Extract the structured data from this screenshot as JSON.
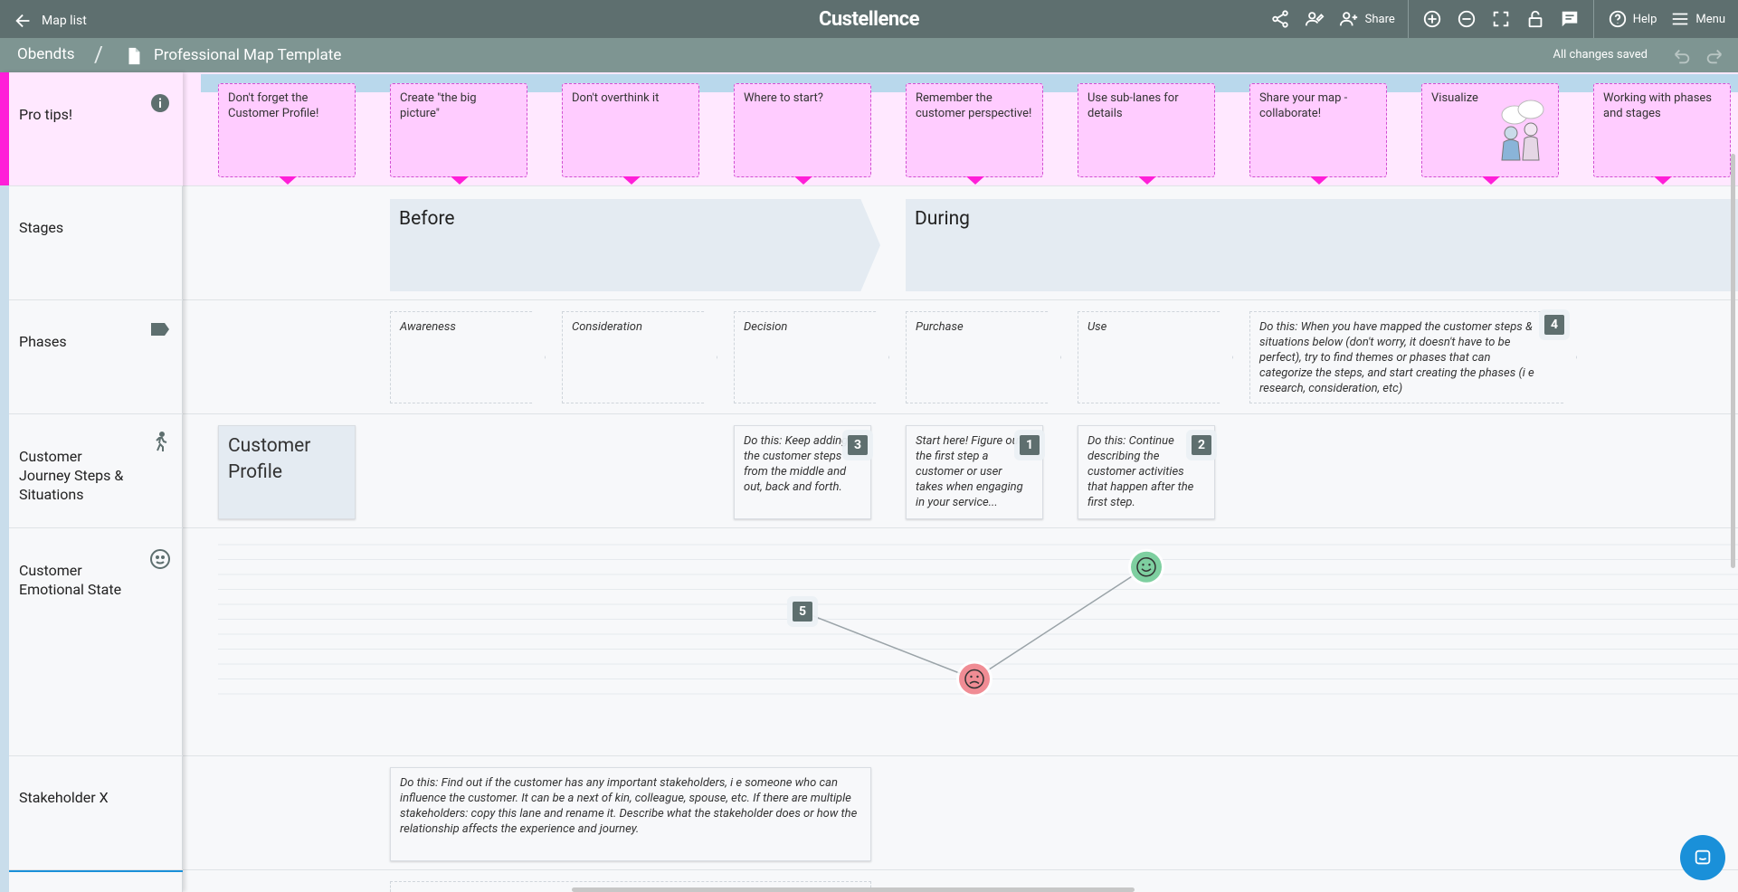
{
  "topbar": {
    "back_label": "Map list",
    "logo": "Custellence",
    "share_label": "Share",
    "help_label": "Help",
    "menu_label": "Menu"
  },
  "subbar": {
    "workspace": "Obendts",
    "separator": "/",
    "map_title": "Professional Map Template",
    "save_status": "All changes saved"
  },
  "lanes": [
    {
      "label": "Pro tips!",
      "icon": "info-icon"
    },
    {
      "label": "Stages",
      "icon": ""
    },
    {
      "label": "Phases",
      "icon": "tag-icon"
    },
    {
      "label": "Customer Journey Steps & Situations",
      "icon": "walking-person-icon"
    },
    {
      "label": "Customer Emotional State",
      "icon": "smiley-icon"
    },
    {
      "label": "Stakeholder X",
      "icon": ""
    }
  ],
  "pro_tips": [
    "Don't forget the Customer Profile!",
    "Create \"the big picture\"",
    "Don't overthink it",
    "Where to start?",
    "Remember the customer perspective!",
    "Use sub-lanes for details",
    "Share your map - collaborate!",
    "Visualize",
    "Working with phases and stages"
  ],
  "stages": [
    "Before",
    "During"
  ],
  "phases": {
    "items": [
      "Awareness",
      "Consideration",
      "Decision",
      "Purchase",
      "Use"
    ],
    "hint": "Do this: When you have mapped the customer steps & situations below (don't worry, it doesn't have to be perfect), try to find themes or phases that can categorize the steps, and start creating the phases (i e research, consideration, etc)",
    "hint_badge": "4"
  },
  "steps": {
    "profile_title": "Customer Profile",
    "cards": [
      {
        "text": "Do this: Keep adding the customer steps from the middle and out, back and forth.",
        "badge": "3"
      },
      {
        "text": "Start here! Figure out the first step a customer or user takes when engaging in your service...",
        "badge": "1"
      },
      {
        "text": "Do this: Continue describing the customer activities that happen after the first step.",
        "badge": "2"
      }
    ]
  },
  "emotions": {
    "badge": "5",
    "points": [
      {
        "step": "Decision",
        "level": 0.55,
        "mood": "neutral"
      },
      {
        "step": "Purchase",
        "level": 0.1,
        "mood": "sad"
      },
      {
        "step": "Use",
        "level": 0.85,
        "mood": "happy"
      }
    ],
    "colors": {
      "happy": "#7ecfa0",
      "sad": "#f08c94"
    }
  },
  "stakeholder": {
    "text": "Do this: Find out if the customer has any important stakeholders, i e someone who can influence the customer. It can be a next of kin, colleague, spouse, etc. If there are multiple stakeholders: copy this lane and rename it. Describe what the stakeholder does or how the relationship affects the experience and journey."
  },
  "colors": {
    "topbar": "#5e6f6f",
    "subbar": "#7e9592",
    "tip_fill": "#ffccff",
    "tip_accent": "#ff1fd8",
    "stage_fill": "#e4ebf2"
  }
}
